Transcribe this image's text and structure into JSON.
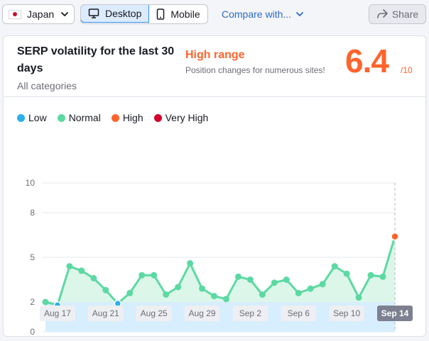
{
  "toolbar": {
    "country": "Japan",
    "device_tabs": [
      "Desktop",
      "Mobile"
    ],
    "active_device": "Desktop",
    "compare_label": "Compare with...",
    "share_label": "Share"
  },
  "card": {
    "title": "SERP volatility for the last 30 days",
    "subtitle": "All categories",
    "range_label": "High range",
    "range_desc": "Position changes for numerous sites!",
    "score": "6.4",
    "score_max": "/10"
  },
  "colors": {
    "accent": "#ff642d",
    "low": "#2bb0eb",
    "normal": "#5cd9a2",
    "high": "#ff642d",
    "very_high": "#d3002c",
    "low_band": "#d6eefd",
    "normal_fill": "#dcf6ea"
  },
  "legend": [
    {
      "label": "Low",
      "color": "#2bb0eb"
    },
    {
      "label": "Normal",
      "color": "#5cd9a2"
    },
    {
      "label": "High",
      "color": "#ff642d"
    },
    {
      "label": "Very High",
      "color": "#d3002c"
    }
  ],
  "chart_data": {
    "type": "line",
    "y_ticks": [
      0,
      2,
      5,
      8,
      10
    ],
    "ylim": [
      0,
      10
    ],
    "x_labels": [
      "Aug 17",
      "Aug 21",
      "Aug 25",
      "Aug 29",
      "Sep 2",
      "Sep 6",
      "Sep 10",
      "Sep 14"
    ],
    "active_x_label": "Sep 14",
    "x_days": [
      "Aug 16",
      "Aug 17",
      "Aug 18",
      "Aug 19",
      "Aug 20",
      "Aug 21",
      "Aug 22",
      "Aug 23",
      "Aug 24",
      "Aug 25",
      "Aug 26",
      "Aug 27",
      "Aug 28",
      "Aug 29",
      "Aug 30",
      "Aug 31",
      "Sep 1",
      "Sep 2",
      "Sep 3",
      "Sep 4",
      "Sep 5",
      "Sep 6",
      "Sep 7",
      "Sep 8",
      "Sep 9",
      "Sep 10",
      "Sep 11",
      "Sep 12",
      "Sep 13",
      "Sep 14"
    ],
    "values": [
      2.0,
      1.8,
      4.4,
      4.1,
      3.6,
      2.8,
      1.9,
      2.6,
      3.8,
      3.8,
      2.5,
      3.0,
      4.6,
      2.9,
      2.4,
      2.2,
      3.7,
      3.5,
      2.5,
      3.3,
      3.5,
      2.6,
      2.9,
      3.2,
      4.4,
      3.9,
      2.3,
      3.8,
      3.7,
      6.4
    ],
    "categories": [
      "normal",
      "low",
      "normal",
      "normal",
      "normal",
      "normal",
      "low",
      "normal",
      "normal",
      "normal",
      "normal",
      "normal",
      "normal",
      "normal",
      "normal",
      "normal",
      "normal",
      "normal",
      "normal",
      "normal",
      "normal",
      "normal",
      "normal",
      "normal",
      "normal",
      "normal",
      "normal",
      "normal",
      "normal",
      "high"
    ],
    "low_threshold": 2
  }
}
